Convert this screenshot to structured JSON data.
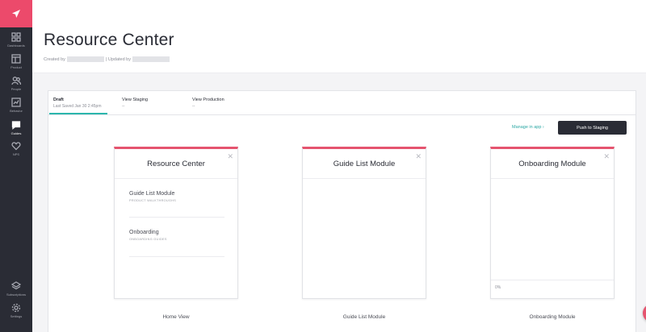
{
  "sidebar": {
    "items": [
      {
        "label": "Dashboards",
        "icon": "grid-icon"
      },
      {
        "label": "Product",
        "icon": "layout-icon"
      },
      {
        "label": "People",
        "icon": "people-icon"
      },
      {
        "label": "Behavior",
        "icon": "chart-icon"
      },
      {
        "label": "Guides",
        "icon": "chat-icon"
      },
      {
        "label": "NPS",
        "icon": "heart-icon"
      }
    ],
    "bottom_items": [
      {
        "label": "Subscriptions",
        "icon": "layers-icon"
      },
      {
        "label": "Settings",
        "icon": "gear-icon"
      }
    ]
  },
  "header": {
    "title": "Resource Center",
    "created_by_label": "Created by",
    "updated_by_label": "| Updated by"
  },
  "tabs": [
    {
      "label": "Draft",
      "sub": "Last Saved Jan 30 2:45pm"
    },
    {
      "label": "View Staging",
      "sub": "--"
    },
    {
      "label": "View Production",
      "sub": "--"
    }
  ],
  "actions": {
    "manage_link": "Manage in app ›",
    "push_button": "Push to Staging"
  },
  "cards": [
    {
      "title": "Resource Center",
      "caption": "Home View",
      "modules": [
        {
          "name": "Guide List Module",
          "sub": "PRODUCT WALKTHROUGHS"
        },
        {
          "name": "Onboarding",
          "sub": "ONBOARDING GUIDES"
        }
      ]
    },
    {
      "title": "Guide List Module",
      "caption": "Guide List Module"
    },
    {
      "title": "Onboarding Module",
      "caption": "Onboarding Module",
      "progress_text": "0%"
    }
  ],
  "colors": {
    "brand": "#e5546f",
    "sidebar": "#2a2c35",
    "accent": "#2bb6ad"
  }
}
